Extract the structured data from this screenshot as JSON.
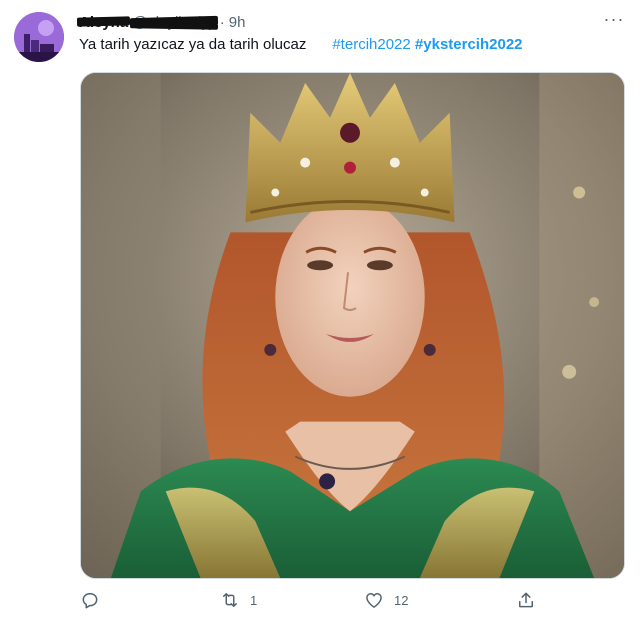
{
  "tweet": {
    "display_name": "Aleyna",
    "handle": "@aleylinalyji",
    "separator": "·",
    "time": "9h",
    "text": "Ya tarih yazıcaz ya da tarih olucaz",
    "hashtags": [
      "#tercih2022",
      "#ykstercih2022"
    ],
    "more_label": "···"
  },
  "actions": {
    "reply_count": "",
    "retweet_count": "1",
    "like_count": "12"
  },
  "colors": {
    "link": "#1d9bf0",
    "text": "#0f1419",
    "secondary": "#536471"
  },
  "icons": [
    "reply-icon",
    "retweet-icon",
    "like-icon",
    "share-icon",
    "more-icon"
  ]
}
